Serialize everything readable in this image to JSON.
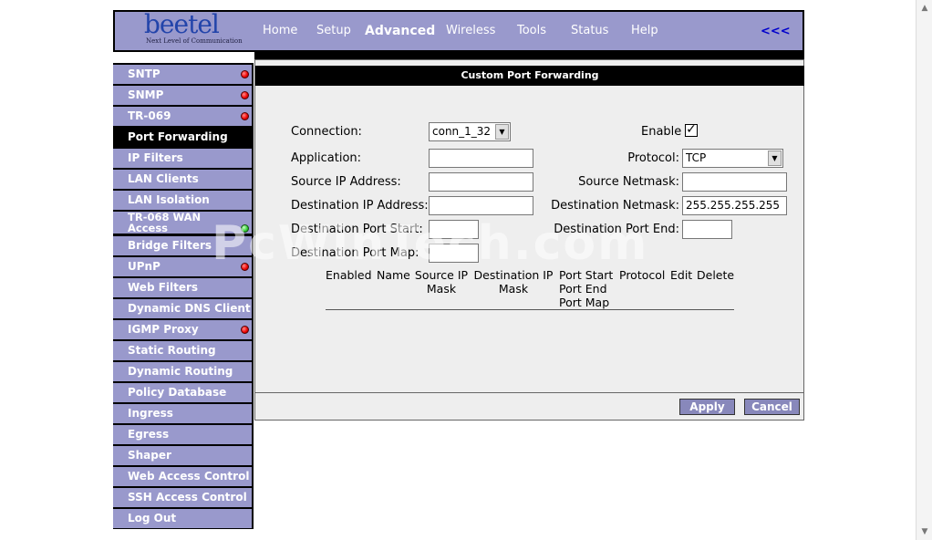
{
  "logo": {
    "brand": "beetel",
    "tagline": "Next Level of Communication"
  },
  "nav": {
    "items": [
      "Home",
      "Setup",
      "Advanced",
      "Wireless",
      "Tools",
      "Status",
      "Help"
    ],
    "active": "Advanced",
    "collapse": "<<<"
  },
  "sidebar": {
    "items": [
      {
        "label": "SNTP",
        "status": "red"
      },
      {
        "label": "SNMP",
        "status": "red"
      },
      {
        "label": "TR-069",
        "status": "red"
      },
      {
        "label": "Port Forwarding",
        "status": "active"
      },
      {
        "label": "IP Filters"
      },
      {
        "label": "LAN Clients"
      },
      {
        "label": "LAN Isolation"
      },
      {
        "label": "TR-068 WAN Access",
        "status": "green"
      },
      {
        "label": "Bridge Filters"
      },
      {
        "label": "UPnP",
        "status": "red"
      },
      {
        "label": "Web Filters"
      },
      {
        "label": "Dynamic DNS Client"
      },
      {
        "label": "IGMP Proxy",
        "status": "red"
      },
      {
        "label": "Static Routing"
      },
      {
        "label": "Dynamic Routing"
      },
      {
        "label": "Policy Database"
      },
      {
        "label": "Ingress"
      },
      {
        "label": "Egress"
      },
      {
        "label": "Shaper"
      },
      {
        "label": "Web Access Control"
      },
      {
        "label": "SSH Access Control"
      },
      {
        "label": "Log Out"
      }
    ]
  },
  "panel": {
    "title": "Custom Port Forwarding",
    "form": {
      "connection_label": "Connection:",
      "connection_value": "conn_1_32",
      "enable_label": "Enable",
      "enable_checked": "✓",
      "application_label": "Application:",
      "application_value": "",
      "protocol_label": "Protocol:",
      "protocol_value": "TCP",
      "src_ip_label": "Source IP Address:",
      "src_ip_value": "",
      "src_mask_label": "Source Netmask:",
      "src_mask_value": "",
      "dst_ip_label": "Destination IP Address:",
      "dst_ip_value": "",
      "dst_mask_label": "Destination Netmask:",
      "dst_mask_value": "255.255.255.255",
      "dst_port_start_label": "Destination Port Start:",
      "dst_port_start_value": "",
      "dst_port_end_label": "Destination Port End:",
      "dst_port_end_value": "",
      "dst_port_map_label": "Destination Port Map:",
      "dst_port_map_value": ""
    },
    "table_headers": {
      "enabled": "Enabled",
      "name": "Name",
      "source_ip": "Source IP",
      "source_mask": "Mask",
      "dest_ip": "Destination IP",
      "dest_mask": "Mask",
      "port_start": "Port Start",
      "port_end": "Port End",
      "port_map": "Port Map",
      "protocol": "Protocol",
      "edit": "Edit",
      "delete": "Delete"
    },
    "buttons": {
      "apply": "Apply",
      "cancel": "Cancel"
    }
  },
  "watermark": "PcWinTech.com",
  "colors": {
    "header_bg": "#9999cc",
    "sidebar_bg": "#9999cc",
    "active_item": "#000000",
    "link_collapse": "#0000cc"
  }
}
